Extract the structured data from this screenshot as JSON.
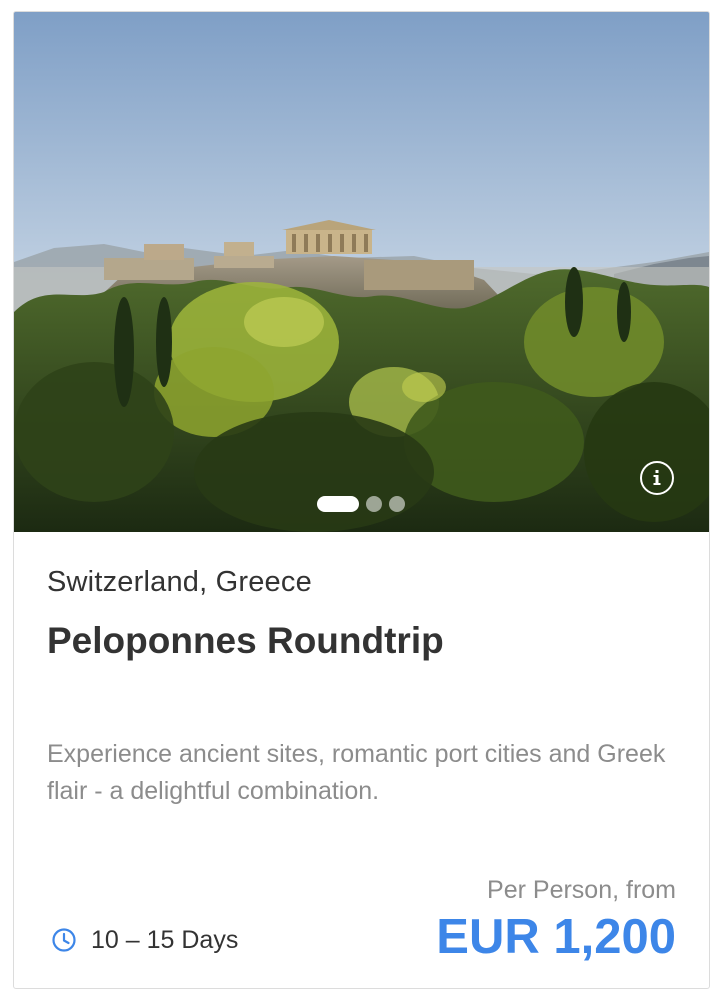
{
  "card": {
    "image_alt": "Acropolis of Athens above green trees",
    "location": "Switzerland, Greece",
    "title": "Peloponnes Roundtrip",
    "description": "Experience ancient sites, romantic port cities and Greek flair - a delightful combination.",
    "duration": "10 – 15 Days",
    "price_label": "Per Person, from",
    "price": "EUR 1,200",
    "info_icon": "info-circle-icon",
    "duration_icon": "clock-icon",
    "carousel": {
      "total": 3,
      "active_index": 0
    },
    "colors": {
      "accent": "#3d86e8",
      "title": "#333333",
      "muted": "#8c8c8c"
    }
  }
}
